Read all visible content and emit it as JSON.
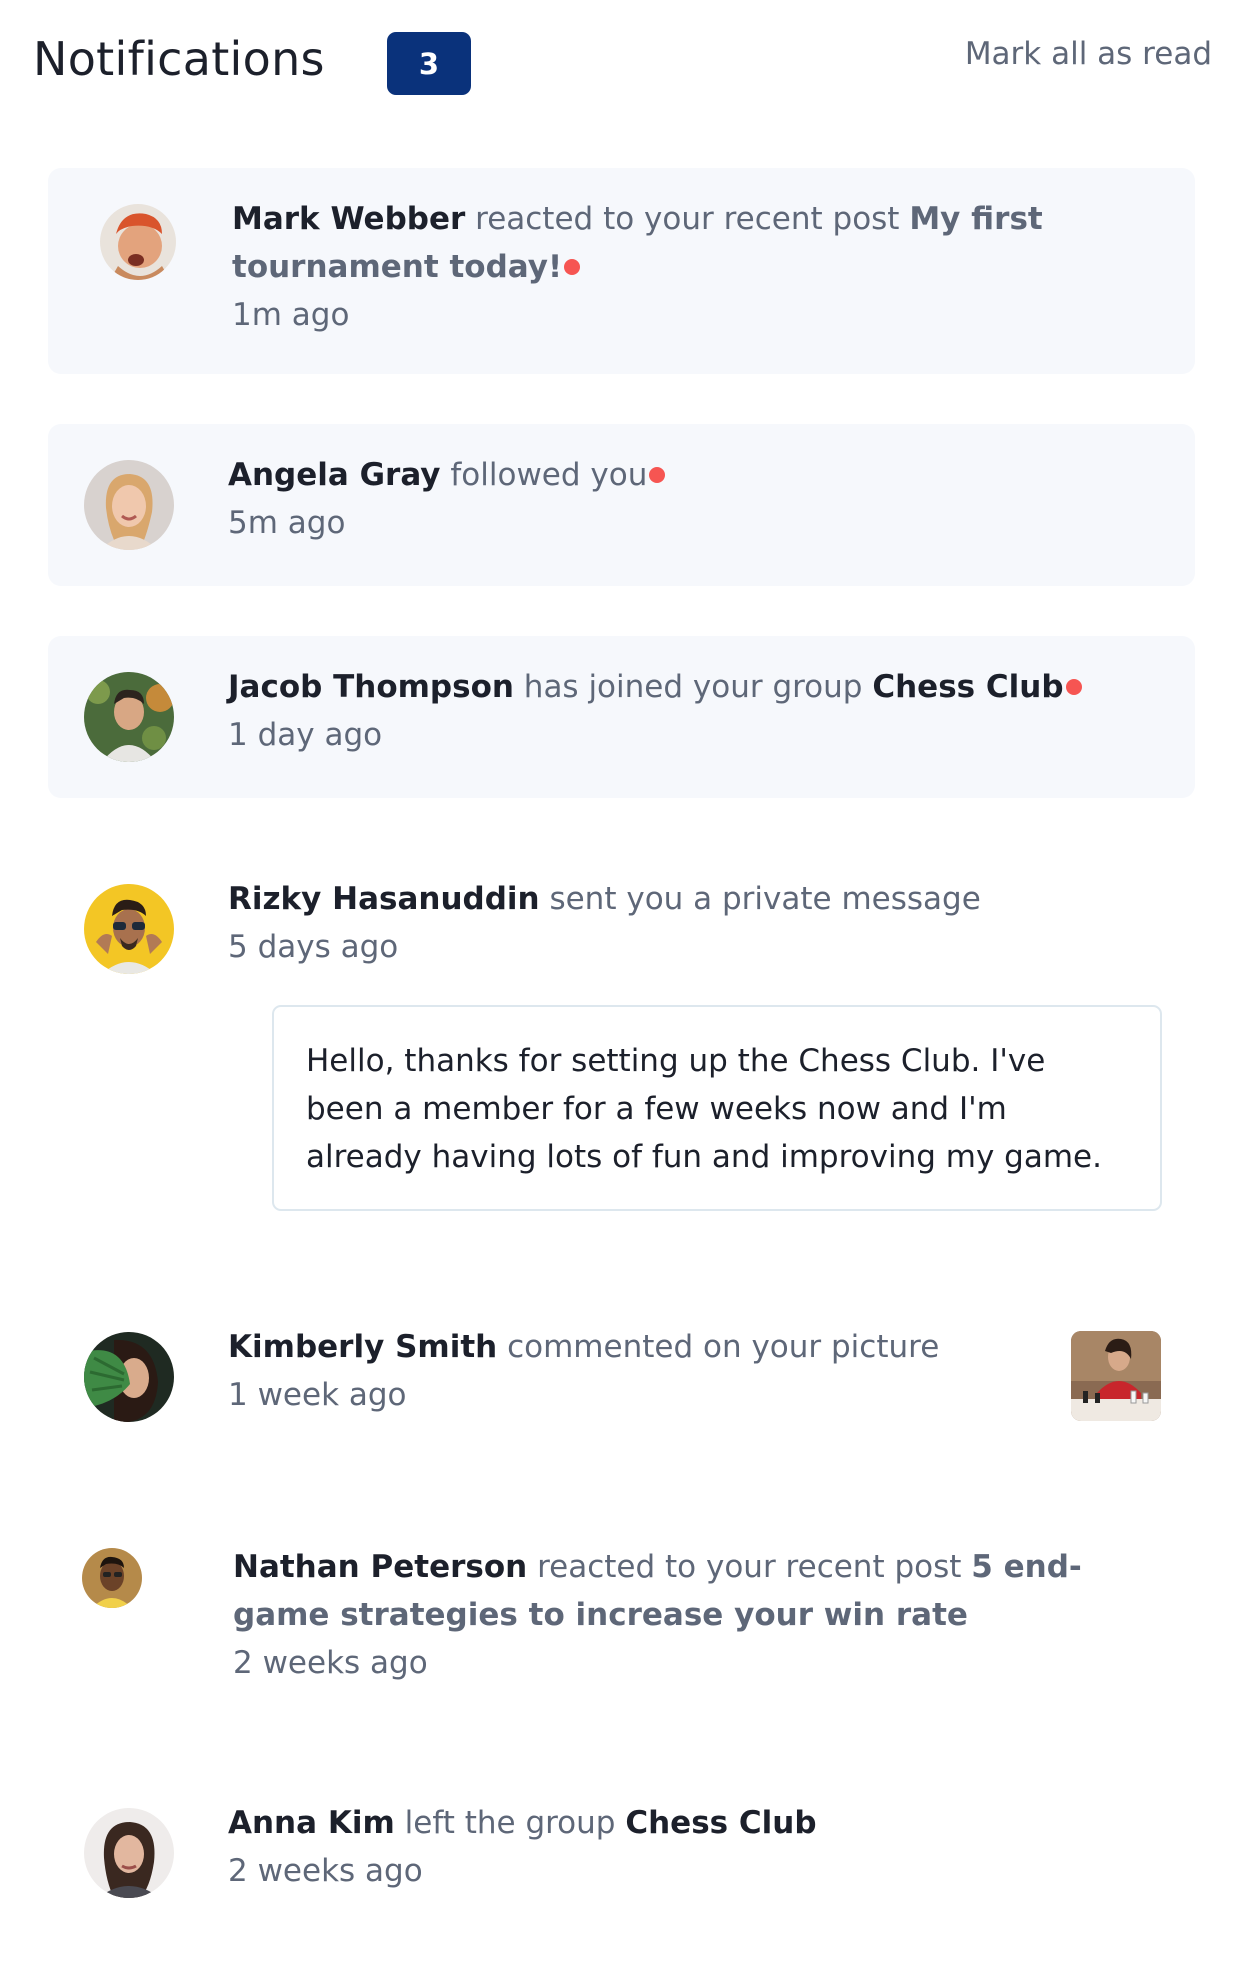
{
  "header": {
    "title": "Notifications",
    "unread_count": "3",
    "mark_all_label": "Mark all as read"
  },
  "colors": {
    "badge": "#0a327b",
    "unread_background": "#f6f8fc",
    "unread_dot": "#f65552",
    "heading_text": "#1c202b",
    "muted_text": "#5e6778"
  },
  "notifications": [
    {
      "name": "Mark Webber",
      "action": " reacted to your recent post ",
      "target": "My first tournament today!",
      "time": "1m ago",
      "unread": true,
      "avatar": "avatar-mark-webber"
    },
    {
      "name": "Angela Gray",
      "action": " followed you",
      "target": "",
      "time": "5m ago",
      "unread": true,
      "avatar": "avatar-angela-gray"
    },
    {
      "name": "Jacob Thompson",
      "action": " has joined your group ",
      "target": "Chess Club",
      "time": "1 day ago",
      "unread": true,
      "avatar": "avatar-jacob-thompson"
    },
    {
      "name": "Rizky Hasanuddin",
      "action": " sent you a private message",
      "target": "",
      "time": "5 days ago",
      "unread": false,
      "avatar": "avatar-rizky-hasanuddin",
      "message": "Hello, thanks for setting up the Chess Club. I've been a member for a few weeks now and I'm already having lots of fun and improving my game."
    },
    {
      "name": "Kimberly Smith",
      "action": " commented on your picture",
      "target": "",
      "time": "1 week ago",
      "unread": false,
      "avatar": "avatar-kimberly-smith",
      "picture": "chess-picture"
    },
    {
      "name": "Nathan Peterson",
      "action": " reacted to your recent post ",
      "target": "5 end-game strategies to increase your win rate",
      "time": "2 weeks ago",
      "unread": false,
      "avatar": "avatar-nathan-peterson"
    },
    {
      "name": "Anna Kim",
      "action": " left the group ",
      "target": "Chess Club",
      "time": "2 weeks ago",
      "unread": false,
      "avatar": "avatar-anna-kim"
    }
  ]
}
